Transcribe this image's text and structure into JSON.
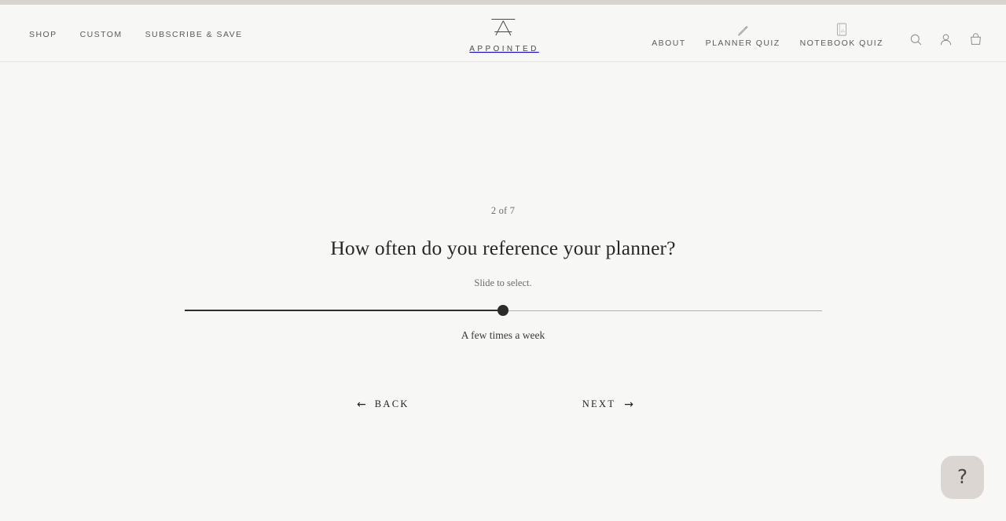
{
  "theme": {
    "page_bg": "#f7f7f6",
    "top_strip": "#d8d3cf",
    "header_border": "#e3e3e1",
    "text_primary": "#272727",
    "text_muted": "#6c6c6c",
    "slider_active": "#2e2e2e",
    "slider_inactive": "#b0b0b0",
    "help_bg": "#dbd6d1"
  },
  "header": {
    "nav_left": [
      {
        "label": "SHOP",
        "name": "nav-shop"
      },
      {
        "label": "CUSTOM",
        "name": "nav-custom"
      },
      {
        "label": "SUBSCRIBE & SAVE",
        "name": "nav-subscribe-save"
      }
    ],
    "logo": {
      "wordmark": "APPOINTED",
      "mark_icon": "appointed-a-monogram-icon"
    },
    "nav_right": [
      {
        "label": "ABOUT",
        "name": "nav-about",
        "icon": null
      },
      {
        "label": "PLANNER QUIZ",
        "name": "nav-planner-quiz",
        "icon": "pencil-icon"
      },
      {
        "label": "NOTEBOOK QUIZ",
        "name": "nav-notebook-quiz",
        "icon": "notebook-icon"
      }
    ],
    "utility_icons": [
      {
        "name": "search-icon",
        "label": "Search"
      },
      {
        "name": "account-icon",
        "label": "Account"
      },
      {
        "name": "shopping-bag-icon",
        "label": "Cart"
      }
    ]
  },
  "quiz": {
    "step_counter": "2 of 7",
    "question": "How often do you reference your planner?",
    "instruction": "Slide to select.",
    "slider": {
      "value_label": "A few times a week",
      "percent": 50,
      "min": 0,
      "max": 100
    },
    "back_button": {
      "label": "BACK",
      "arrow": "←"
    },
    "next_button": {
      "label": "NEXT",
      "arrow": "→"
    }
  },
  "help": {
    "glyph": "?",
    "name": "help-launcher-button"
  }
}
